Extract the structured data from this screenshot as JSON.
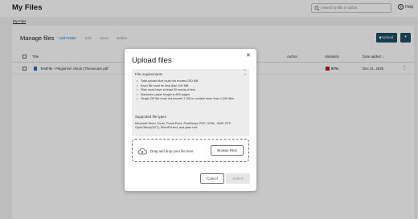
{
  "header": {
    "title": "My Files",
    "search_placeholder": "Search by title or author",
    "help_label": "Help"
  },
  "breadcrumb": "My Files",
  "toolbar": {
    "title": "Manage files",
    "add_folder": "Add Folder",
    "edit": "Edit",
    "move": "Move",
    "delete": "Delete",
    "upload": "Upload",
    "more": "▾"
  },
  "table": {
    "columns": [
      "Title",
      "Author",
      "Similarity",
      "Date added"
    ],
    "sort_indicator": "↓",
    "rows": [
      {
        "title": "TestFile - Plagiarism check (Themecare.pdf",
        "author": "",
        "similarity": "97%",
        "similarity_color": "#c0182b",
        "date": "Dec 31, 2025"
      }
    ]
  },
  "modal": {
    "title": "Upload files",
    "requirements_heading": "File requirements",
    "requirements": [
      "Total upload size must not exceed 250 MB",
      "Each file must be less than 100 MB",
      "Files must have at least 20 words of text",
      "Maximum paper length is 800 pages",
      "Single ZIP file must not exceed 1 GB or contain more than 1,000 files"
    ],
    "types_heading": "Supported file types",
    "types_text": "Microsoft Word, Excel, PowerPoint, PostScript, PDF, HTML, HWP, RTF, OpenOffice(ODT), WordPerfect, and plain text",
    "drop_text": "Drag and drop your file here",
    "browse_label": "Browse Files",
    "cancel_label": "Cancel",
    "submit_label": "Submit"
  },
  "colors": {
    "primary": "#1e4d63",
    "link": "#2a6fbf",
    "similarity_high": "#c0182b"
  }
}
